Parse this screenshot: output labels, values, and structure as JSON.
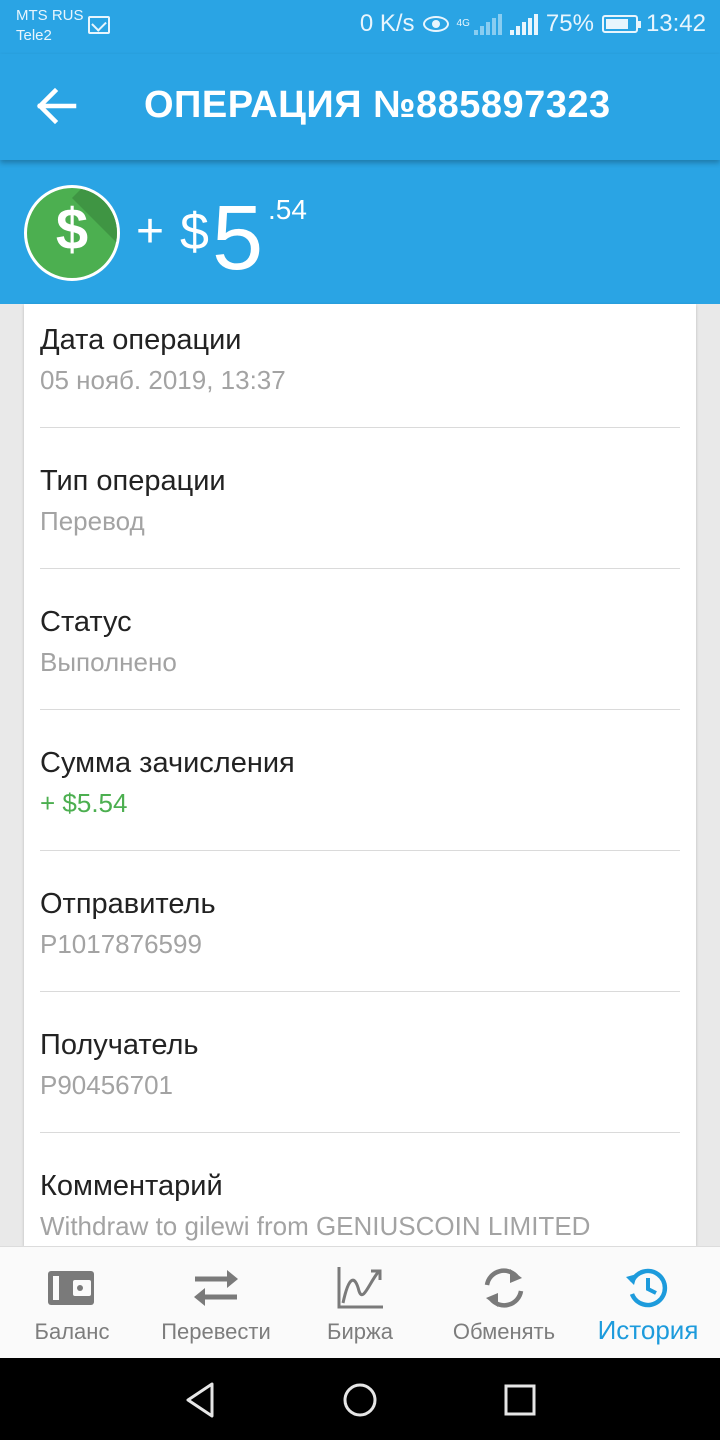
{
  "status_bar": {
    "carrier1": "MTS RUS",
    "carrier2": "Tele2",
    "network_speed": "0 K/s",
    "network_type": "4G",
    "battery": "75%",
    "time": "13:42"
  },
  "header": {
    "title": "ОПЕРАЦИЯ №885897323"
  },
  "amount": {
    "sign": "+",
    "currency": "$",
    "whole": "5",
    "cents": ".54",
    "coin_symbol": "$"
  },
  "details": [
    {
      "label": "Дата операции",
      "value": "05 нояб. 2019, 13:37"
    },
    {
      "label": "Тип операции",
      "value": "Перевод"
    },
    {
      "label": "Статус",
      "value": "Выполнено"
    },
    {
      "label": "Сумма зачисления",
      "value": "+ $5.54"
    },
    {
      "label": "Отправитель",
      "value": "P1017876599"
    },
    {
      "label": "Получатель",
      "value": "P90456701"
    },
    {
      "label": "Комментарий",
      "value": "Withdraw to gilewi from GENIUSCOIN LIMITED"
    }
  ],
  "bottom_nav": {
    "items": [
      {
        "label": "Баланс",
        "icon": "wallet-icon"
      },
      {
        "label": "Перевести",
        "icon": "transfer-arrows-icon"
      },
      {
        "label": "Биржа",
        "icon": "chart-icon"
      },
      {
        "label": "Обменять",
        "icon": "exchange-refresh-icon"
      },
      {
        "label": "История",
        "icon": "history-icon"
      }
    ],
    "active": "История"
  },
  "colors": {
    "primary": "#2aa4e4",
    "accent_active": "#1d9bdc",
    "credit_green": "#4caf50",
    "muted_text": "#a3a3a3"
  }
}
